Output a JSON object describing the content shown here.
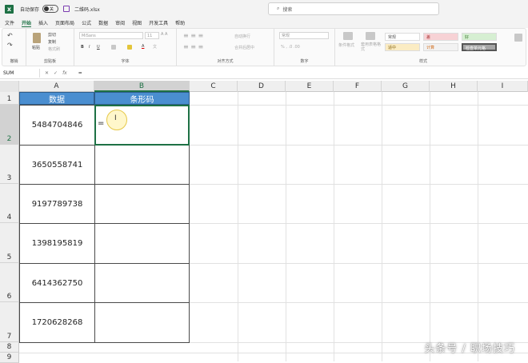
{
  "titlebar": {
    "autosave_label": "自动保存",
    "toggle_state": "关",
    "filename": "二维码.xlsx",
    "search_placeholder": "搜索"
  },
  "menu": [
    "文件",
    "开始",
    "插入",
    "页面布局",
    "公式",
    "数据",
    "审阅",
    "视图",
    "开发工具",
    "帮助"
  ],
  "ribbon": {
    "clipboard": {
      "label": "剪贴板",
      "paste": "粘贴",
      "cut": "剪切",
      "copy": "复制",
      "format_painter": "格式刷",
      "undo_label": "撤销"
    },
    "font": {
      "label": "字体",
      "font_name": "MiSans",
      "font_size": "11"
    },
    "alignment": {
      "label": "对齐方式",
      "wrap": "自动换行",
      "merge": "合并后居中"
    },
    "number": {
      "label": "数字",
      "format": "常规"
    },
    "styles": {
      "label": "样式",
      "conditional": "条件格式",
      "table": "套用表格格式",
      "cells": [
        "常规",
        "差",
        "好",
        "适中",
        "计算",
        "检查单元格"
      ]
    }
  },
  "formula_bar": {
    "name_box": "SUM",
    "cancel": "✕",
    "enter": "✓",
    "fx": "fx",
    "value": "="
  },
  "columns": [
    "A",
    "B",
    "C",
    "D",
    "E",
    "F",
    "G",
    "H",
    "I"
  ],
  "rows": [
    "1",
    "2",
    "3",
    "4",
    "5",
    "6",
    "7",
    "8",
    "9"
  ],
  "table": {
    "header_a": "数据",
    "header_b": "条形码",
    "values": [
      "5484704846",
      "3650558741",
      "9197789738",
      "1398195819",
      "6414362750",
      "1720628268"
    ],
    "editing_b2": "="
  },
  "watermark": "头条号 / 职场技巧",
  "colors": {
    "accent": "#1e7145",
    "header_fill": "#4a8ed0"
  }
}
